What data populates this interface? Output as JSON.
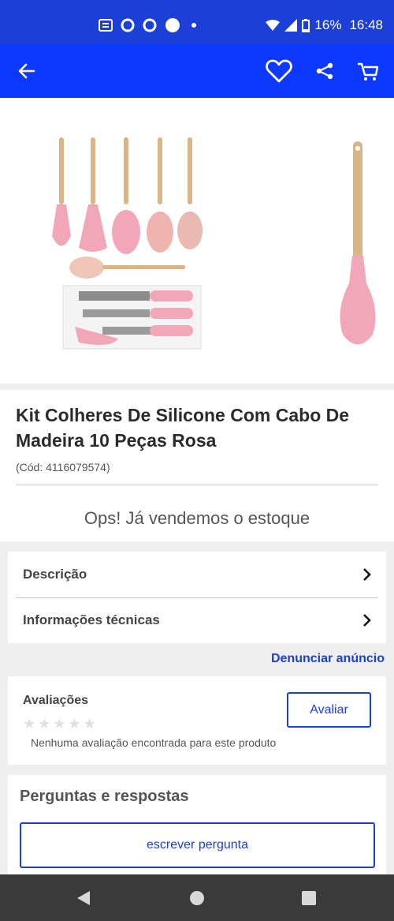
{
  "status_bar": {
    "battery": "16%",
    "time": "16:48",
    "icons": [
      "news-icon",
      "circle-outline-icon",
      "circle-outline-icon",
      "circle-filled-icon",
      "dot-icon",
      "wifi-icon",
      "signal-icon",
      "battery-icon"
    ]
  },
  "app_bar": {
    "icons": [
      "back-arrow-icon",
      "heart-icon",
      "share-icon",
      "cart-icon"
    ],
    "color": "#0d38fd"
  },
  "product": {
    "title": "Kit Colheres De Silicone Com Cabo De Madeira 10 Peças Rosa",
    "code": "(Cód: 4116079574)",
    "stock_message": "Ops! Já vendemos o estoque"
  },
  "menu": {
    "items": [
      {
        "label": "Descrição"
      },
      {
        "label": "Informações técnicas"
      }
    ]
  },
  "report_link": "Denunciar anúncio",
  "reviews": {
    "title": "Avaliações",
    "rate_button": "Avaliar",
    "empty_message": "Nenhuma avaliação encontrada para este produto",
    "rating_stars": 0,
    "max_stars": 5
  },
  "qa": {
    "title": "Perguntas e respostas",
    "ask_button": "escrever pergunta"
  },
  "nav_bar": {
    "icons": [
      "back-triangle-icon",
      "home-circle-icon",
      "recents-square-icon"
    ]
  },
  "colors": {
    "status_bar": "#1c3fd8",
    "accent": "#1c3fd8",
    "product_pink": "#f2a7b8",
    "wood": "#d9b68a"
  }
}
